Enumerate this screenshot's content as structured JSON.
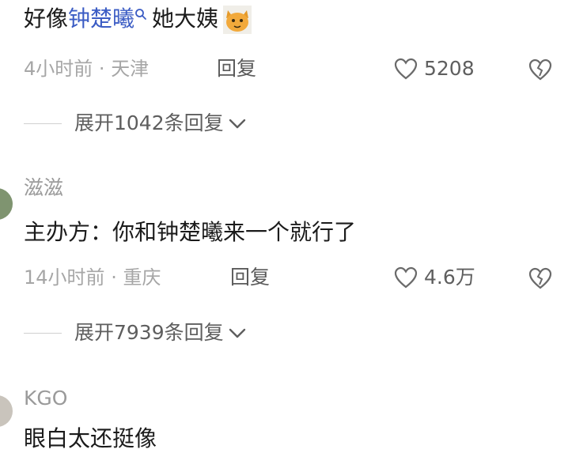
{
  "comment1": {
    "text_before": "好像",
    "keyword": "钟楚曦",
    "text_after": "她大姨",
    "emoji": "cat-face-emoji",
    "time": "4小时前",
    "location": "天津",
    "reply_label": "回复",
    "likes": "5208",
    "expand_label": "展开1042条回复"
  },
  "comment2": {
    "username": "滋滋",
    "text": "主办方：你和钟楚曦来一个就行了",
    "time": "14小时前",
    "location": "重庆",
    "reply_label": "回复",
    "likes": "4.6万",
    "expand_label": "展开7939条回复"
  },
  "comment3": {
    "username": "KGO",
    "text": "眼白太还挺像"
  },
  "colors": {
    "keyword": "#3b5cc4",
    "meta": "#a6a6a6"
  }
}
